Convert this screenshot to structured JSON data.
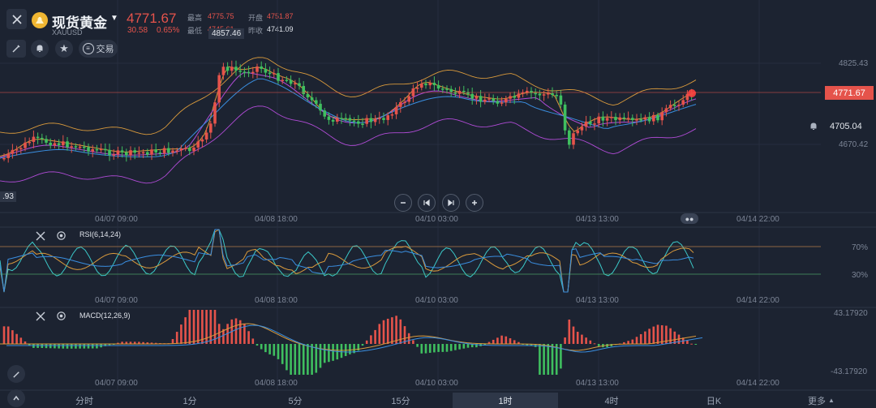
{
  "header": {
    "title": "现货黄金",
    "symbol": "XAUUSD",
    "price": "4771.67",
    "change": "30.58",
    "change_pct": "0.65%",
    "high_label": "最高",
    "high_value": "4775.75",
    "open_label": "开盘",
    "open_value": "4751.87",
    "low_label": "最低",
    "low_value": "4745.61",
    "prev_label": "昨收",
    "prev_value": "4741.09",
    "trade_label": "交易"
  },
  "main_chart": {
    "max_marker": "4857.46",
    "min_marker_partial": ".93",
    "price_ticks": [
      "4825.43",
      "4670.42"
    ],
    "current_price_tag": "4771.67",
    "alert_price": "4705.04",
    "time_labels": [
      "04/07 09:00",
      "04/08 18:00",
      "04/10 03:00",
      "04/13 13:00",
      "04/14 22:00"
    ]
  },
  "rsi": {
    "label": "RSI(6,14,24)",
    "level_high": "70%",
    "level_low": "30%",
    "time_labels": [
      "04/07 09:00",
      "04/08 18:00",
      "04/10 03:00",
      "04/13 13:00",
      "04/14 22:00"
    ]
  },
  "macd": {
    "label": "MACD(12,26,9)",
    "max_value": "43.17920",
    "min_value": "-43.17920",
    "time_labels": [
      "04/07 09:00",
      "04/08 18:00",
      "04/10 03:00",
      "04/13 13:00",
      "04/14 22:00"
    ]
  },
  "timeframes": [
    "分时",
    "1分",
    "5分",
    "15分",
    "1时",
    "4时",
    "日K",
    "更多"
  ],
  "active_timeframe": "1时",
  "colors": {
    "background": "#1c2331",
    "up": "#e5534b",
    "down": "#3fbf5f",
    "price_tag": "#e5534b",
    "ma_orange": "#d99a3c",
    "ma_purple": "#b04bd6",
    "ma_blue": "#3a8ee0",
    "rsi_teal": "#3bc9c9"
  }
}
